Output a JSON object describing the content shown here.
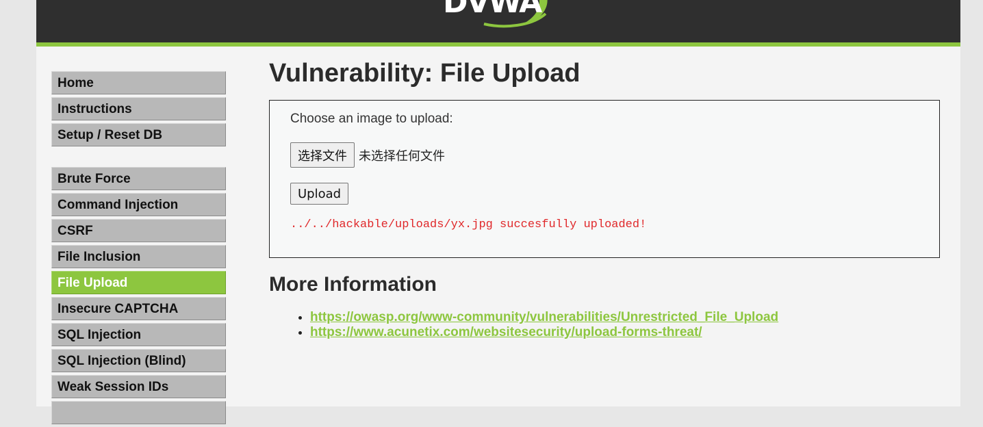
{
  "header": {
    "logo_text": "DVWA"
  },
  "menu": {
    "group1": [
      {
        "label": "Home"
      },
      {
        "label": "Instructions"
      },
      {
        "label": "Setup / Reset DB"
      }
    ],
    "group2": [
      {
        "label": "Brute Force"
      },
      {
        "label": "Command Injection"
      },
      {
        "label": "CSRF"
      },
      {
        "label": "File Inclusion"
      },
      {
        "label": "File Upload",
        "selected": true
      },
      {
        "label": "Insecure CAPTCHA"
      },
      {
        "label": "SQL Injection"
      },
      {
        "label": "SQL Injection (Blind)"
      },
      {
        "label": "Weak Session IDs"
      }
    ]
  },
  "main": {
    "title": "Vulnerability: File Upload",
    "form": {
      "prompt": "Choose an image to upload:",
      "choose_file_label": "选择文件",
      "file_status": "未选择任何文件",
      "upload_label": "Upload",
      "result_message": "../../hackable/uploads/yx.jpg succesfully uploaded!"
    },
    "more_info": {
      "title": "More Information",
      "links": [
        "https://owasp.org/www-community/vulnerabilities/Unrestricted_File_Upload",
        "https://www.acunetix.com/websitesecurity/upload-forms-threat/"
      ]
    }
  },
  "colors": {
    "accent": "#8dc63f",
    "header_bg": "#2f2f2f",
    "result_text": "#e0282a"
  }
}
